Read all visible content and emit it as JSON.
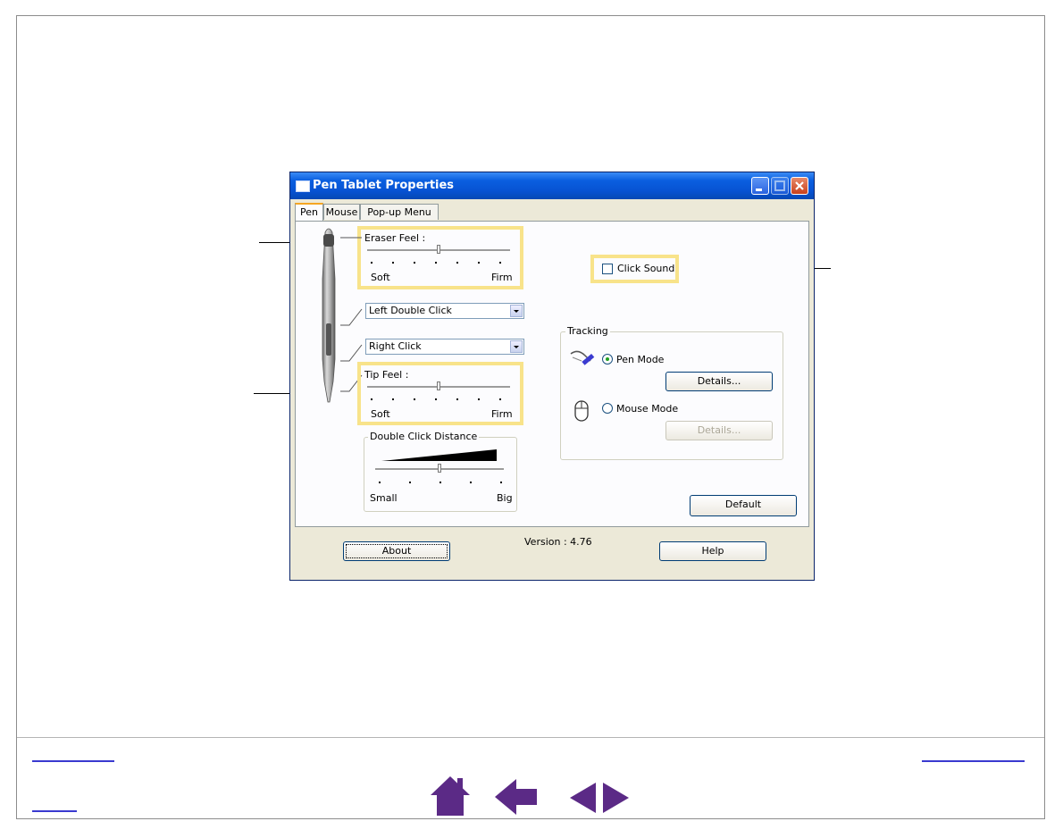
{
  "window": {
    "title": "Pen Tablet Properties",
    "tabs": [
      {
        "label": "Pen",
        "active": true
      },
      {
        "label": "Mouse",
        "active": false
      },
      {
        "label": "Pop-up Menu",
        "active": false
      }
    ],
    "eraser_feel": {
      "label": "Eraser Feel :",
      "min_label": "Soft",
      "max_label": "Firm",
      "level": 0.5
    },
    "upper_button": {
      "value": "Left Double Click"
    },
    "lower_button": {
      "value": "Right Click"
    },
    "tip_feel": {
      "label": "Tip Feel :",
      "min_label": "Soft",
      "max_label": "Firm",
      "level": 0.5
    },
    "double_click_distance": {
      "label": "Double Click Distance",
      "min_label": "Small",
      "max_label": "Big",
      "level": 0.5
    },
    "click_sound": {
      "label": "Click Sound",
      "checked": false
    },
    "tracking": {
      "label": "Tracking",
      "pen_mode": {
        "label": "Pen Mode",
        "selected": true,
        "details_label": "Details..."
      },
      "mouse_mode": {
        "label": "Mouse Mode",
        "selected": false,
        "details_label": "Details..."
      }
    },
    "default_label": "Default",
    "about_label": "About",
    "version": "Version : 4.76",
    "help_label": "Help"
  },
  "colors": {
    "highlight": "#f8e38a",
    "title_bar": "#0752d2",
    "nav_icons": "#5b2a86",
    "link": "#3a3ad0"
  },
  "footer": {
    "nav_icons": [
      "home-icon",
      "back-arrow-icon",
      "previous-page-icon",
      "next-page-icon"
    ]
  }
}
